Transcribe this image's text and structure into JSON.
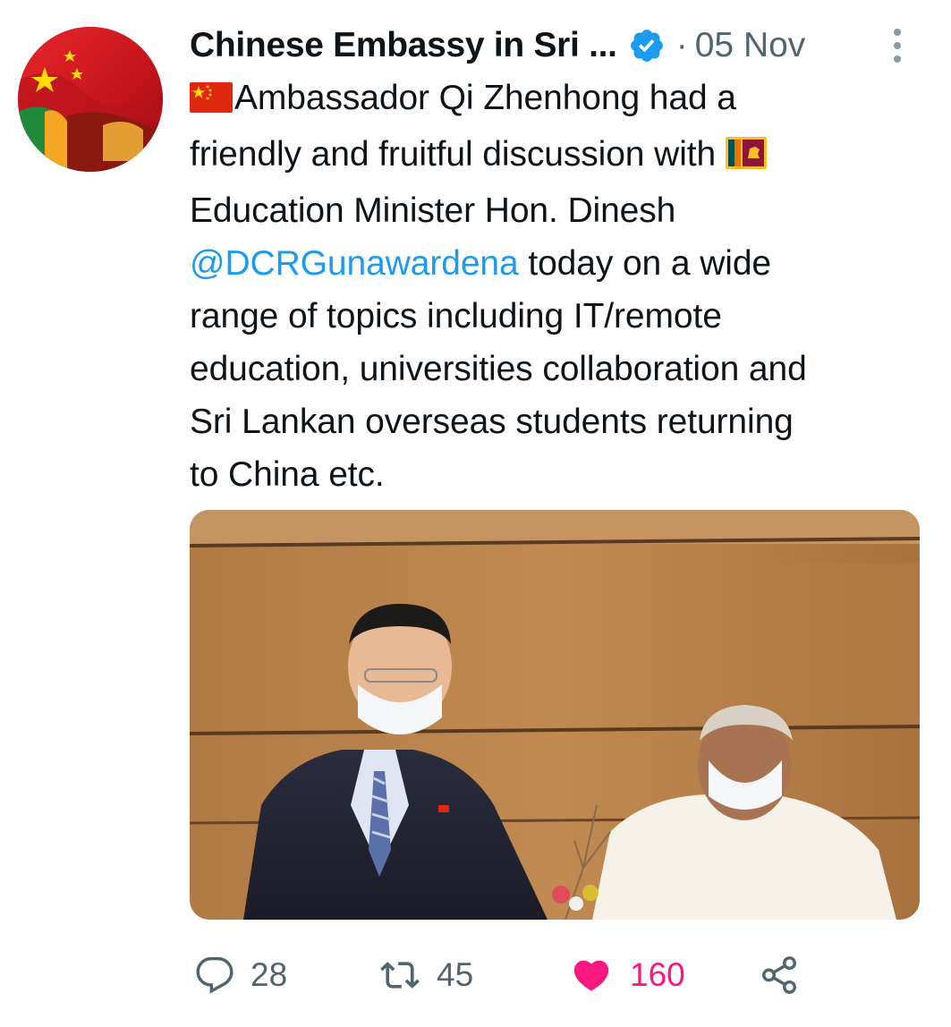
{
  "tweet": {
    "display_name": "Chinese Embassy in Sri ...",
    "separator": "·",
    "date": "05 Nov",
    "lines": [
      "Ambassador Qi Zhenhong had a",
      "friendly and fruitful discussion with",
      "Education Minister Hon. Dinesh",
      "@DCRGunawardena",
      " today on a wide",
      "range of topics including IT/remote",
      "education, universities collaboration and",
      "Sri Lankan overseas students returning",
      "to China etc."
    ],
    "icons": {
      "verified": "verified-badge-icon",
      "flag_cn": "china-flag-icon",
      "flag_lk": "sri-lanka-flag-icon",
      "more": "more-options-icon"
    }
  },
  "actions": {
    "reply_count": "28",
    "retweet_count": "45",
    "like_count": "160"
  },
  "colors": {
    "link": "#1d9bf0",
    "muted": "#536471",
    "like": "#f91880",
    "verified": "#1d9bf0"
  }
}
